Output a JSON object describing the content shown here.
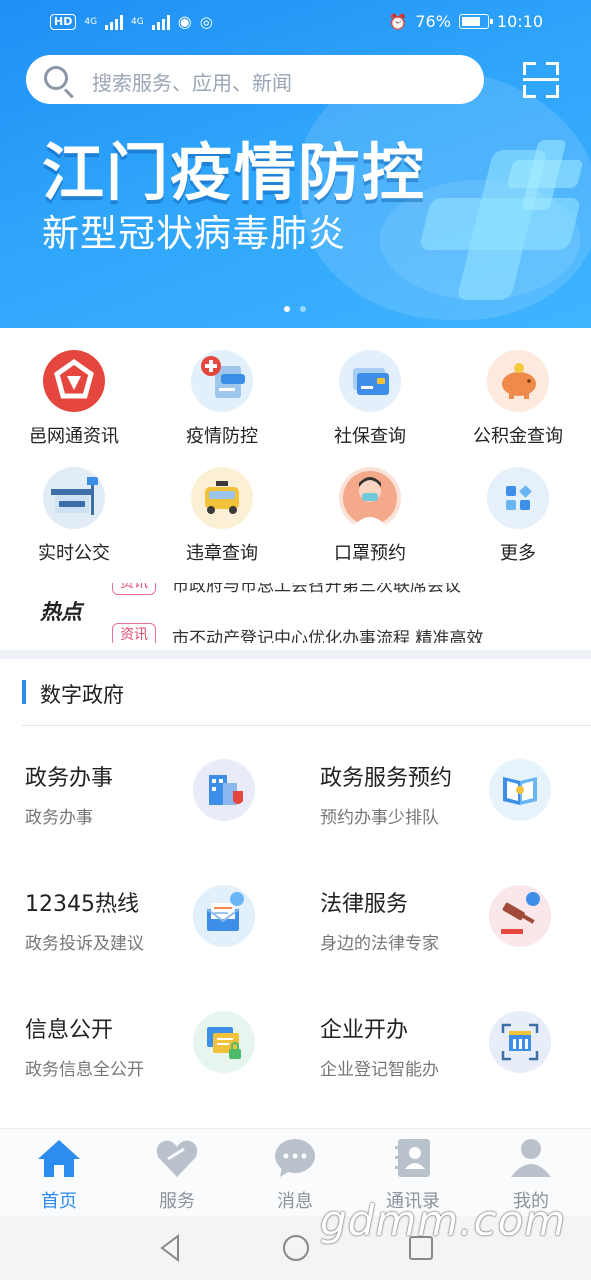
{
  "status_bar": {
    "net_label": "HD",
    "net_type1": "4G",
    "net_type2": "4G",
    "battery": "76%",
    "time": "10:10"
  },
  "search": {
    "placeholder": "搜索服务、应用、新闻"
  },
  "banner": {
    "title": "江门疫情防控",
    "subtitle": "新型冠状病毒肺炎",
    "active_dot": 0,
    "dots": 2
  },
  "quick_grid": [
    {
      "label": "邑网通资讯",
      "icon": "news-logo-icon"
    },
    {
      "label": "疫情防控",
      "icon": "epidemic-control-icon"
    },
    {
      "label": "社保查询",
      "icon": "social-security-card-icon"
    },
    {
      "label": "公积金查询",
      "icon": "piggy-bank-icon"
    },
    {
      "label": "实时公交",
      "icon": "bus-stop-icon"
    },
    {
      "label": "违章查询",
      "icon": "taxi-icon"
    },
    {
      "label": "口罩预约",
      "icon": "doctor-mask-icon"
    },
    {
      "label": "更多",
      "icon": "more-grid-icon"
    }
  ],
  "hotspot": {
    "logo": "热点",
    "items": [
      {
        "tag": "资讯",
        "text": "市政府与市总工会召开第三次联席会议"
      },
      {
        "tag": "资讯",
        "text": "市不动产登记中心优化办事流程 精准高效"
      }
    ]
  },
  "section": {
    "title": "数字政府"
  },
  "services": [
    {
      "title": "政务办事",
      "subtitle": "政务办事",
      "icon": "government-building-icon"
    },
    {
      "title": "政务服务预约",
      "subtitle": "预约办事少排队",
      "icon": "appointment-book-icon"
    },
    {
      "title": "12345热线",
      "subtitle": "政务投诉及建议",
      "icon": "hotline-mail-icon"
    },
    {
      "title": "法律服务",
      "subtitle": "身边的法律专家",
      "icon": "gavel-icon"
    },
    {
      "title": "信息公开",
      "subtitle": "政务信息全公开",
      "icon": "info-document-icon"
    },
    {
      "title": "企业开办",
      "subtitle": "企业登记智能办",
      "icon": "enterprise-building-icon"
    }
  ],
  "bottom_nav": [
    {
      "label": "首页",
      "icon": "home-icon",
      "active": true
    },
    {
      "label": "服务",
      "icon": "heart-hands-icon",
      "active": false
    },
    {
      "label": "消息",
      "icon": "chat-bubble-icon",
      "active": false
    },
    {
      "label": "通讯录",
      "icon": "contacts-book-icon",
      "active": false
    },
    {
      "label": "我的",
      "icon": "user-profile-icon",
      "active": false
    }
  ],
  "watermark": "gdmm.com",
  "colors": {
    "accent": "#2d8cf0",
    "banner": "#2ea4fb",
    "tag": "#e34a6f"
  }
}
